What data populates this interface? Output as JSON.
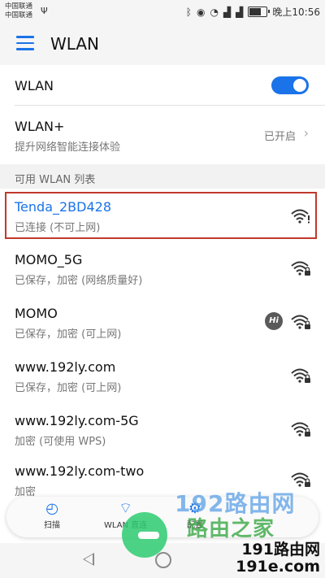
{
  "status_bar": {
    "carrier1": "中国联通",
    "carrier2": "中国联通",
    "time": "晚上10:56"
  },
  "header": {
    "title": "WLAN"
  },
  "wlan_toggle": {
    "label": "WLAN",
    "on": true
  },
  "wlan_plus": {
    "title": "WLAN+",
    "subtitle": "提升网络智能连接体验",
    "state": "已开启"
  },
  "section": {
    "title": "可用 WLAN 列表"
  },
  "networks": [
    {
      "name": "Tenda_2BD428",
      "status": "已连接 (不可上网)",
      "connected": true
    },
    {
      "name": "MOMO_5G",
      "status": "已保存，加密 (网络质量好)"
    },
    {
      "name": "MOMO",
      "status": "已保存，加密 (可上网)",
      "badge": "Hi"
    },
    {
      "name": "www.192ly.com",
      "status": "已保存，加密 (可上网)"
    },
    {
      "name": "www.192ly.com-5G",
      "status": "加密 (可使用 WPS)"
    },
    {
      "name": "www.192ly.com-two",
      "status": "加密"
    }
  ],
  "bottom_bar": {
    "scan": "扫描",
    "wlan_direct": "WLAN 直连",
    "config": "配置"
  },
  "watermark": {
    "line1": "192路由网",
    "line2": "路由之家",
    "line3a": "191路由网",
    "line3b": "191e.com"
  },
  "colors": {
    "accent": "#1a73e8",
    "highlight": "#c0392b"
  }
}
